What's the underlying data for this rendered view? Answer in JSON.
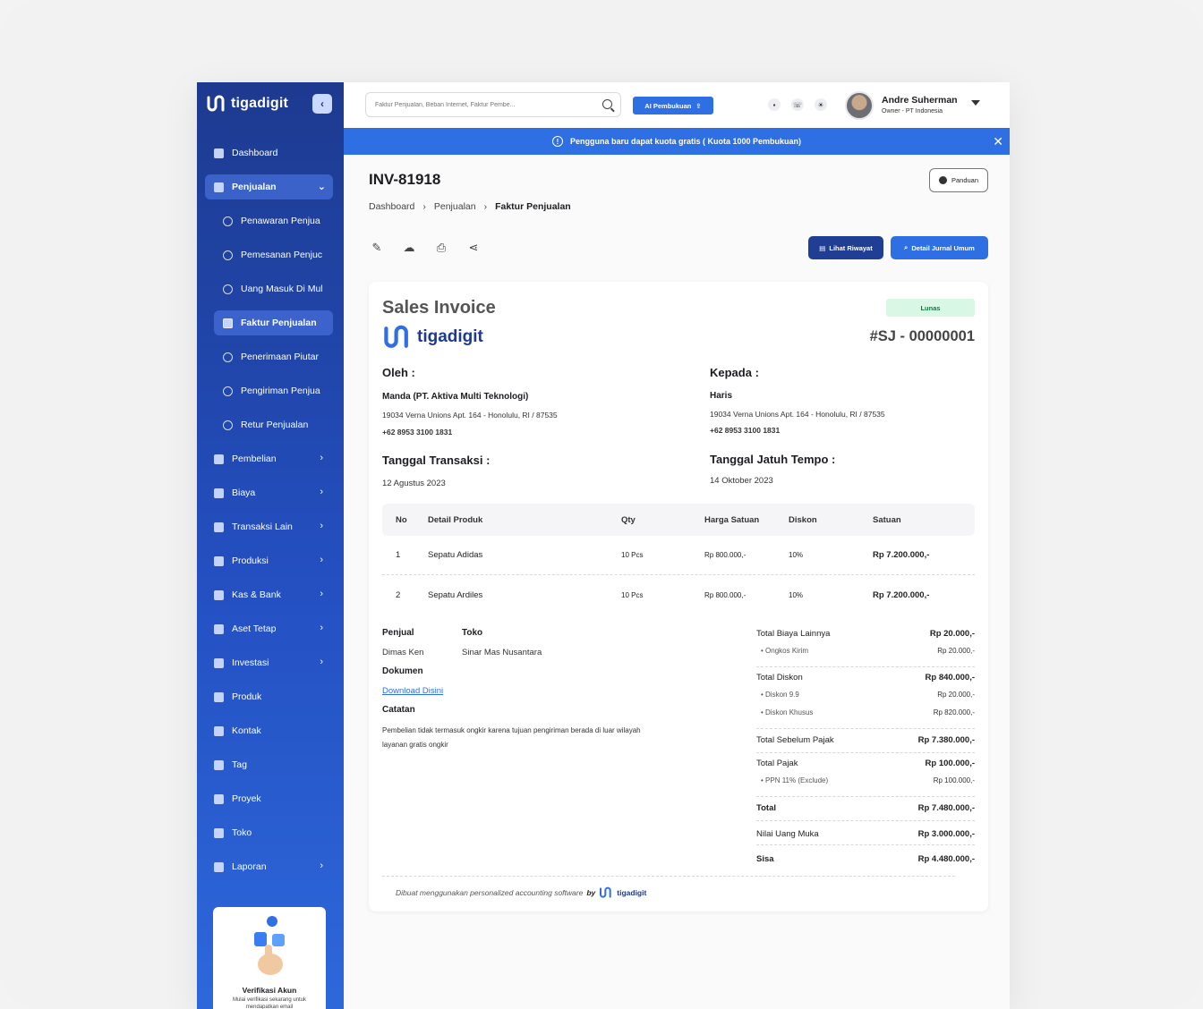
{
  "sidebar": {
    "brand": "tigadigit",
    "items": [
      {
        "label": "Dashboard"
      },
      {
        "label": "Penjualan"
      },
      {
        "label": "Penawaran Penjua"
      },
      {
        "label": "Pemesanan Penjuc"
      },
      {
        "label": "Uang Masuk Di Mul"
      },
      {
        "label": "Faktur Penjualan"
      },
      {
        "label": "Penerimaan Piutar"
      },
      {
        "label": "Pengiriman Penjua"
      },
      {
        "label": "Retur Penjualan"
      },
      {
        "label": "Pembelian"
      },
      {
        "label": "Biaya"
      },
      {
        "label": "Transaksi Lain"
      },
      {
        "label": "Produksi"
      },
      {
        "label": "Kas & Bank"
      },
      {
        "label": "Aset Tetap"
      },
      {
        "label": "Investasi"
      },
      {
        "label": "Produk"
      },
      {
        "label": "Kontak"
      },
      {
        "label": "Tag"
      },
      {
        "label": "Proyek"
      },
      {
        "label": "Toko"
      },
      {
        "label": "Laporan"
      }
    ],
    "verify": {
      "title": "Verifikasi Akun",
      "desc": "Mulai verifikasi sekarang untuk mendapatkan email"
    }
  },
  "topbar": {
    "search_placeholder": "Faktur Penjualan, Beban Internet, Faktur Pembe...",
    "ai_button": "AI Pembukuan",
    "user_name": "Andre Suherman",
    "user_role": "Owner - PT Indonesia"
  },
  "banner": {
    "text": "Pengguna baru dapat kuota gratis ( Kuota 1000 Pembukuan)"
  },
  "page": {
    "title": "INV-81918",
    "guide_button": "Panduan",
    "breadcrumb": [
      "Dashboard",
      "Penjualan",
      "Faktur Penjualan"
    ],
    "history_button": "Lihat Riwayat",
    "journal_button": "Detail Jurnal Umum"
  },
  "invoice": {
    "title": "Sales Invoice",
    "brand": "tigadigit",
    "status": "Lunas",
    "number": "#SJ - 00000001",
    "from_label": "Oleh :",
    "from_name": "Manda (PT. Aktiva Multi Teknologi)",
    "from_address": "19034 Verna Unions Apt. 164 - Honolulu, RI / 87535",
    "from_phone": "+62 8953 3100 1831",
    "to_label": "Kepada :",
    "to_name": "Haris",
    "to_address": "19034 Verna Unions Apt. 164 - Honolulu, RI / 87535",
    "to_phone": "+62 8953 3100 1831",
    "trx_date_label": "Tanggal Transaksi :",
    "trx_date": "12 Agustus 2023",
    "due_date_label": "Tanggal Jatuh Tempo :",
    "due_date": "14 Oktober 2023",
    "columns": [
      "No",
      "Detail Produk",
      "Qty",
      "Harga Satuan",
      "Diskon",
      "Satuan"
    ],
    "rows": [
      {
        "no": "1",
        "product": "Sepatu Adidas",
        "qty": "10 Pcs",
        "price": "Rp 800.000,-",
        "discount": "10%",
        "total": "Rp 7.200.000,-"
      },
      {
        "no": "2",
        "product": "Sepatu Ardiles",
        "qty": "10 Pcs",
        "price": "Rp 800.000,-",
        "discount": "10%",
        "total": "Rp 7.200.000,-"
      }
    ],
    "seller_label": "Penjual",
    "seller": "Dimas Ken",
    "store_label": "Toko",
    "store": "Sinar Mas Nusantara",
    "doc_label": "Dokumen",
    "doc_link": "Download Disini",
    "notes_label": "Catatan",
    "notes": "Pembelian tidak termasuk ongkir karena tujuan pengiriman berada di luar wilayah layanan gratis ongkir",
    "summary": {
      "other_label": "Total Biaya Lainnya",
      "other": "Rp 20.000,-",
      "shipping_label": "Ongkos Kirim",
      "shipping": "Rp 20.000,-",
      "discount_label": "Total Diskon",
      "discount": "Rp 840.000,-",
      "disc1_label": "Diskon 9.9",
      "disc1": "Rp 20.000,-",
      "disc2_label": "Diskon Khusus",
      "disc2": "Rp 820.000,-",
      "pretax_label": "Total Sebelum Pajak",
      "pretax": "Rp 7.380.000,-",
      "tax_label": "Total Pajak",
      "tax": "Rp 100.000,-",
      "ppn_label": "PPN 11% (Exclude)",
      "ppn": "Rp 100.000,-",
      "total_label": "Total",
      "total": "Rp 7.480.000,-",
      "dp_label": "Nilai Uang Muka",
      "dp": "Rp 3.000.000,-",
      "rest_label": "Sisa",
      "rest": "Rp 4.480.000,-"
    },
    "footer": "Dibuat menggunakan personalized accounting software",
    "footer_by": "by",
    "footer_brand": "tigadigit"
  },
  "colors": {
    "primary": "#2f6fe4",
    "sidebar": "#1d3a8f",
    "success_bg": "#d8f7e4"
  }
}
